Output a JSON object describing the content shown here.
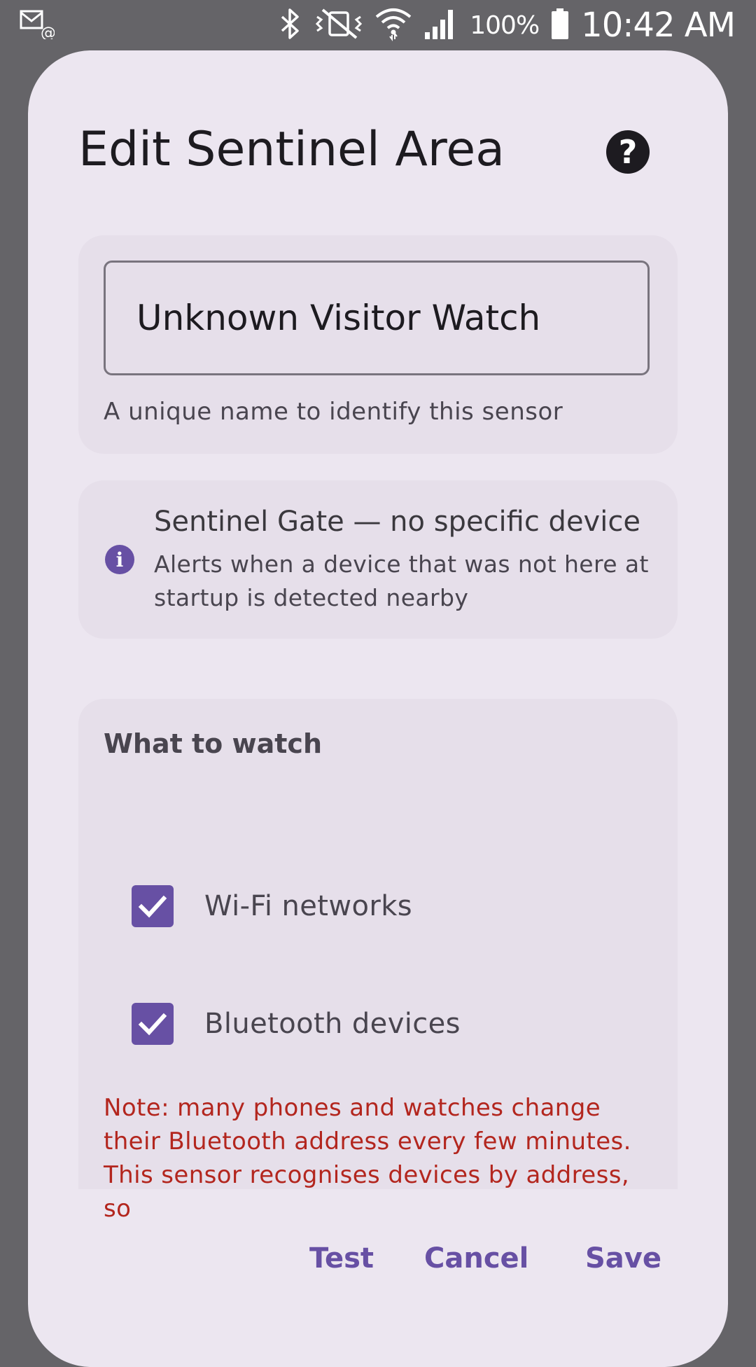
{
  "status_bar": {
    "battery": "100%",
    "time": "10:42 AM",
    "icons": [
      "notification-email-icon",
      "bluetooth-icon",
      "vibrate-mute-icon",
      "wifi-icon",
      "signal-icon",
      "battery-icon"
    ]
  },
  "dialog": {
    "title": "Edit Sentinel Area",
    "help_icon": "help-circle-icon",
    "name_field": {
      "value": "Unknown Visitor Watch",
      "helper": "A unique name to identify this sensor"
    },
    "info": {
      "icon": "info-icon",
      "title": "Sentinel Gate — no specific device",
      "description": "Alerts when a device that was not here at startup is detected nearby"
    },
    "watch": {
      "title": "What to watch",
      "options": [
        {
          "label": "Wi-Fi networks",
          "checked": true
        },
        {
          "label": "Bluetooth devices",
          "checked": true
        }
      ],
      "note": "Note: many phones and watches change their Bluetooth address every few minutes. This sensor recognises devices by address, so"
    },
    "actions": {
      "test": "Test",
      "cancel": "Cancel",
      "save": "Save"
    }
  },
  "colors": {
    "primary": "#6750a4",
    "error": "#b3261e",
    "surface": "#ece6f0",
    "scrim": "#656468"
  }
}
